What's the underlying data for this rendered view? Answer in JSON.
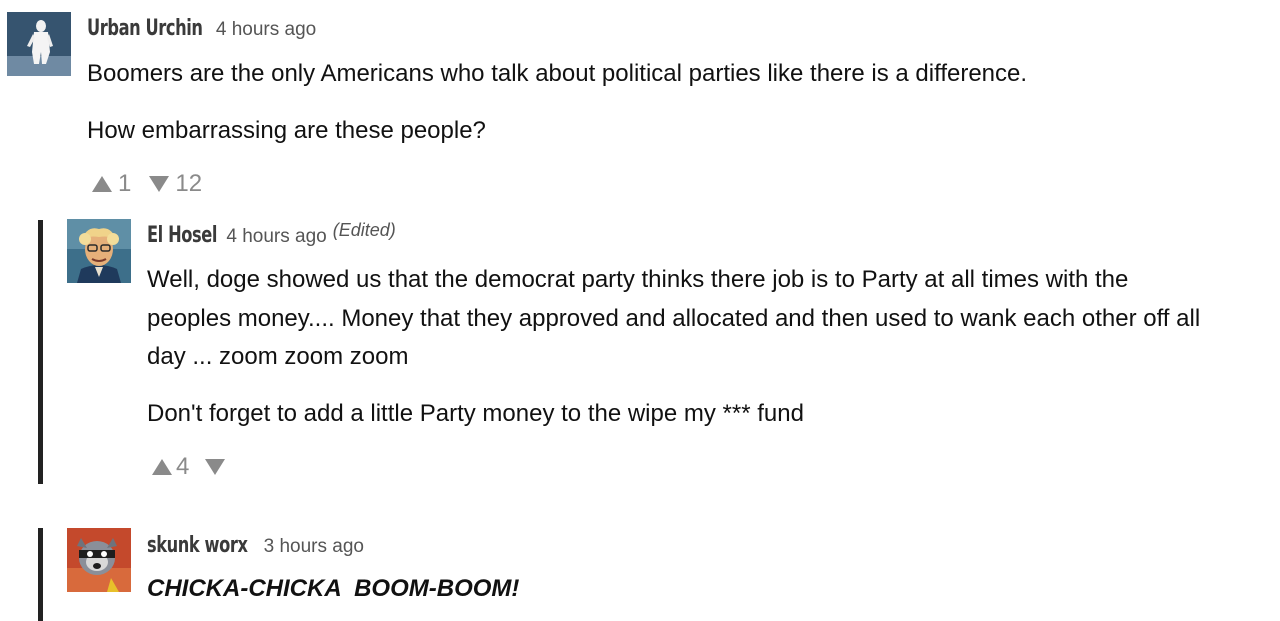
{
  "comments": [
    {
      "username": "Urban Urchin",
      "time": "4 hours ago",
      "paragraphs": [
        "Boomers are the only Americans who talk about political parties like there is a difference.",
        "How embarrassing are these people?"
      ],
      "upvotes": "1",
      "downvotes": "12"
    },
    {
      "username": "El Hosel",
      "time": "4 hours ago",
      "edited": "(Edited)",
      "paragraphs": [
        "Well, doge showed us that the democrat party thinks there job is to Party at all times with the",
        "peoples money.... Money that they approved and allocated and then used to wank each other off all",
        "day ... zoom zoom zoom",
        "Don't forget to add a little Party money to the wipe my *** fund"
      ],
      "upvotes": "4",
      "downvotes": ""
    },
    {
      "username": "skunk worx",
      "time": "3 hours ago",
      "paragraphs": [
        "CHICKA-CHICKA  BOOM-BOOM!"
      ]
    }
  ],
  "icons": {
    "upvote": "triangle-up-icon",
    "downvote": "triangle-down-icon"
  },
  "colors": {
    "thread_bar": "#222222",
    "vote_gray": "#8a8a8a",
    "meta_gray": "#555555"
  }
}
